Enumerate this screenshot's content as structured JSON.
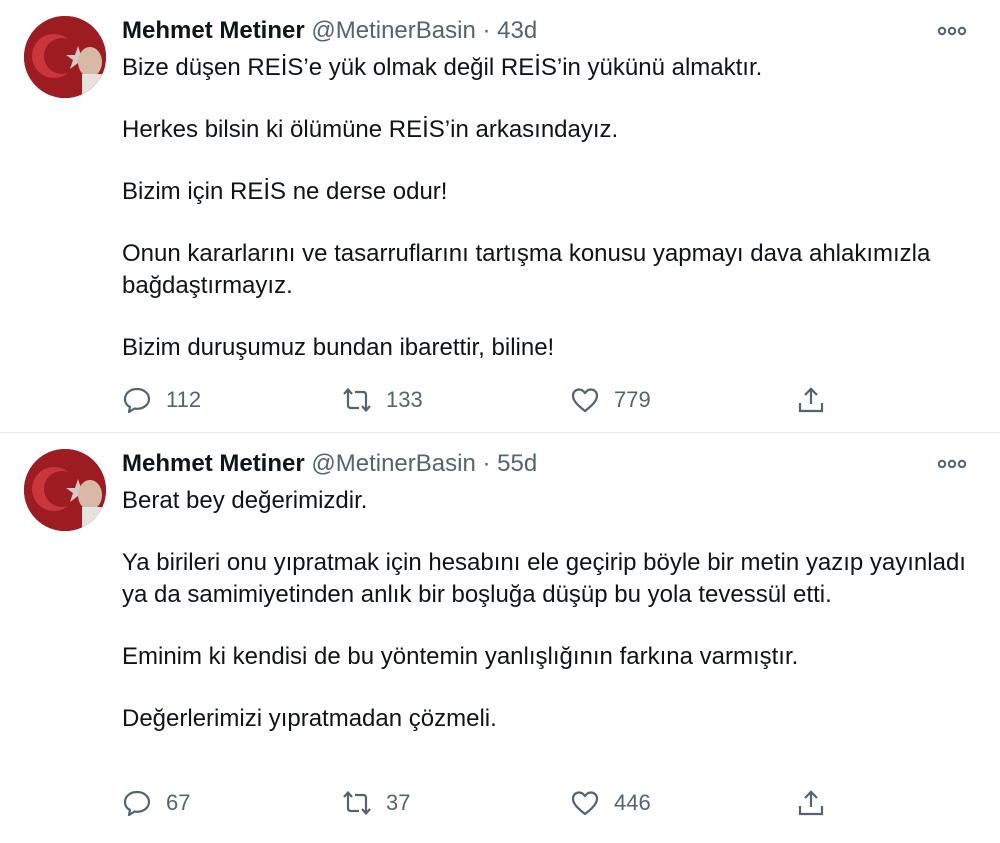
{
  "colors": {
    "text": "#0f1419",
    "secondary": "#536471",
    "divider": "#e6ecf0"
  },
  "tweets": [
    {
      "author": "Mehmet Metiner",
      "handle": "@MetinerBasin",
      "dot": "·",
      "time": "43d",
      "paragraphs": [
        "Bize düşen REİS’e yük olmak değil REİS’in yükünü almaktır.",
        "Herkes bilsin ki ölümüne REİS’in arkasındayız.",
        "Bizim için REİS ne derse odur!",
        "Onun kararlarını ve tasarruflarını tartışma konusu yapmayı dava ahlakımızla bağdaştırmayız.",
        "Bizim duruşumuz bundan ibarettir, biline!"
      ],
      "replies": "112",
      "retweets": "133",
      "likes": "779"
    },
    {
      "author": "Mehmet Metiner",
      "handle": "@MetinerBasin",
      "dot": "·",
      "time": "55d",
      "paragraphs": [
        "Berat bey değerimizdir.",
        "Ya birileri onu yıpratmak için hesabını ele geçirip böyle bir metin yazıp yayınladı ya da samimiyetinden anlık bir boşluğa düşüp bu yola tevessül etti.",
        "Eminim ki kendisi de bu yöntemin yanlışlığının farkına varmıştır.",
        "Değerlerimizi yıpratmadan çözmeli."
      ],
      "replies": "67",
      "retweets": "37",
      "likes": "446"
    }
  ],
  "icons": {
    "more": "more-icon",
    "reply": "reply-icon",
    "retweet": "retweet-icon",
    "like": "heart-icon",
    "share": "share-icon"
  }
}
